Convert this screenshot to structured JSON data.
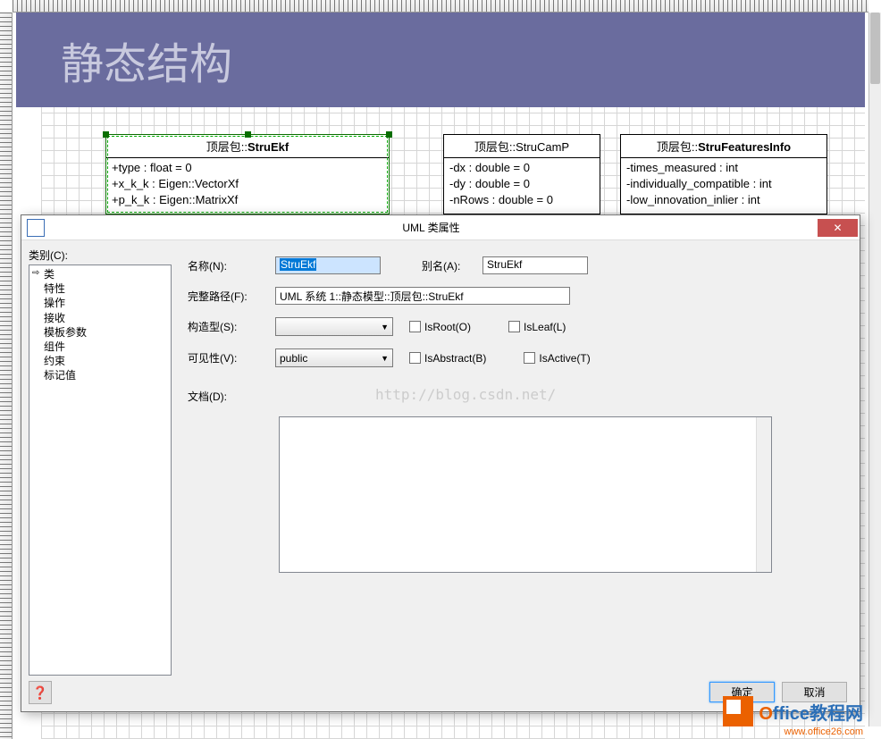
{
  "background": {
    "title": "静态结构"
  },
  "uml": {
    "box1": {
      "title_prefix": "顶层包::",
      "title_name": "StruEkf",
      "attrs": [
        "+type : float = 0",
        "+x_k_k : Eigen::VectorXf",
        "+p_k_k : Eigen::MatrixXf"
      ]
    },
    "box2": {
      "title_prefix": "顶层包::",
      "title_name": "StruCamP",
      "attrs": [
        "-dx : double = 0",
        "-dy : double = 0",
        "-nRows : double = 0"
      ]
    },
    "box3": {
      "title_prefix": "顶层包::",
      "title_name": "StruFeaturesInfo",
      "attrs": [
        "-times_measured  : int",
        "-individually_compatible : int",
        "-low_innovation_inlier : int"
      ]
    }
  },
  "dialog": {
    "title": "UML 类属性",
    "category_label": "类别(C):",
    "categories": [
      "类",
      "特性",
      "操作",
      "接收",
      "模板参数",
      "组件",
      "约束",
      "标记值"
    ],
    "fields": {
      "name_label": "名称(N):",
      "name_value": "StruEkf",
      "alias_label": "别名(A):",
      "alias_value": "StruEkf",
      "path_label": "完整路径(F):",
      "path_value": "UML 系统 1::静态模型::顶层包::StruEkf",
      "stereo_label": "构造型(S):",
      "vis_label": "可见性(V):",
      "vis_value": "public",
      "doc_label": "文档(D):",
      "isroot": "IsRoot(O)",
      "isleaf": "IsLeaf(L)",
      "isabstract": "IsAbstract(B)",
      "isactive": "IsActive(T)"
    },
    "watermark": "http://blog.csdn.net/",
    "help": "?",
    "ok": "确定",
    "cancel": "取消"
  },
  "branding": {
    "text_o": "O",
    "text_rest": "ffice教程网",
    "url": "www.office26.com"
  }
}
